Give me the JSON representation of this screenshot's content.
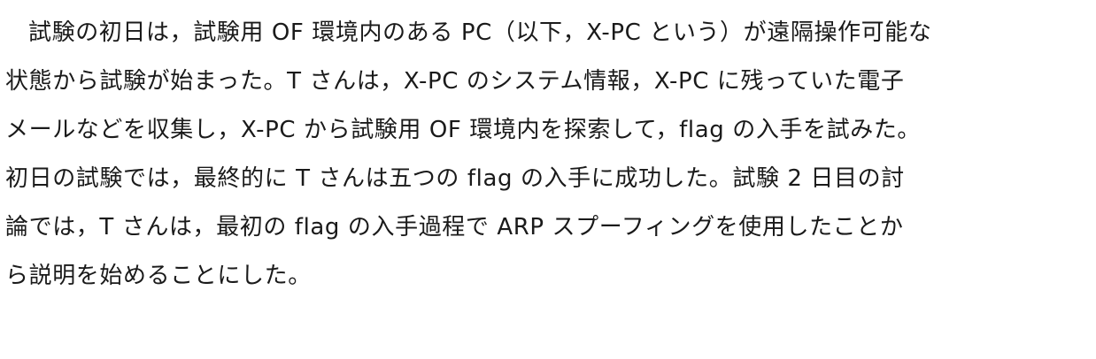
{
  "document": {
    "paragraph": {
      "lines": [
        "試験の初日は，試験用 OF 環境内のある PC（以下，X-PC という）が遠隔操作可能な",
        "状態から試験が始まった。T さんは，X-PC のシステム情報，X-PC に残っていた電子",
        "メールなどを収集し，X-PC から試験用 OF 環境内を探索して，flag の入手を試みた。",
        "初日の試験では，最終的に T さんは五つの flag の入手に成功した。試験 2 日目の討",
        "論では，T さんは，最初の flag の入手過程で ARP スプーフィングを使用したことか",
        "ら説明を始めることにした。"
      ]
    }
  }
}
